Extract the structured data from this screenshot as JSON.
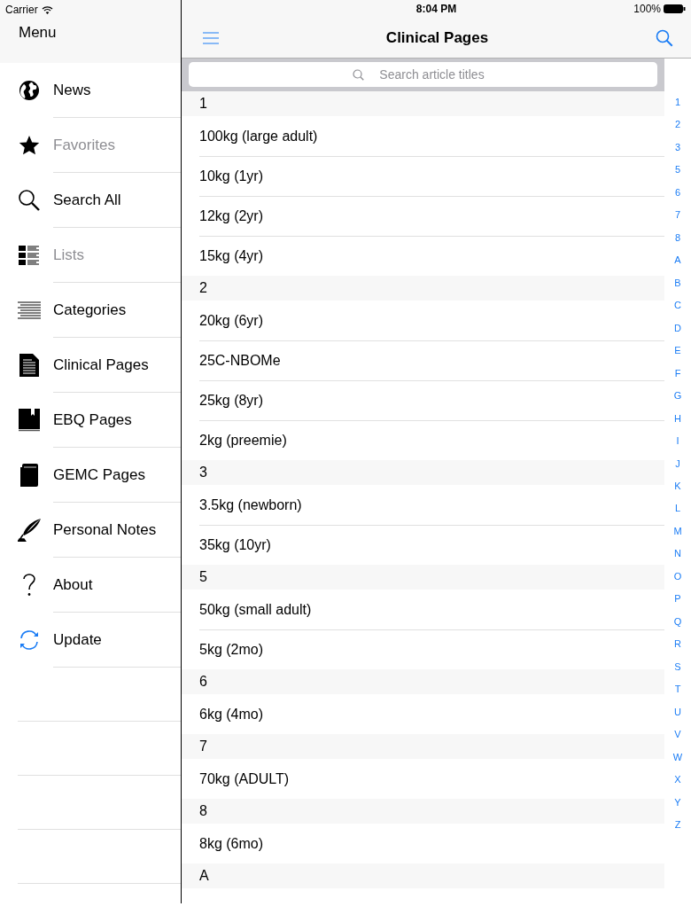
{
  "status_bar": {
    "carrier": "Carrier",
    "time": "8:04 PM",
    "battery": "100%"
  },
  "sidebar": {
    "title": "Menu",
    "items": [
      {
        "label": "News",
        "disabled": false
      },
      {
        "label": "Favorites",
        "disabled": true
      },
      {
        "label": "Search All",
        "disabled": false
      },
      {
        "label": "Lists",
        "disabled": true
      },
      {
        "label": "Categories",
        "disabled": false
      },
      {
        "label": "Clinical Pages",
        "disabled": false
      },
      {
        "label": "EBQ Pages",
        "disabled": false
      },
      {
        "label": "GEMC Pages",
        "disabled": false
      },
      {
        "label": "Personal Notes",
        "disabled": false
      },
      {
        "label": "About",
        "disabled": false
      },
      {
        "label": "Update",
        "disabled": false
      }
    ]
  },
  "nav_bar": {
    "title": "Clinical Pages"
  },
  "search": {
    "placeholder": "Search article titles"
  },
  "sections": [
    {
      "header": "1",
      "rows": [
        "100kg (large adult)",
        "10kg (1yr)",
        "12kg (2yr)",
        "15kg (4yr)"
      ]
    },
    {
      "header": "2",
      "rows": [
        "20kg (6yr)",
        "25C-NBOMe",
        "25kg (8yr)",
        "2kg (preemie)"
      ]
    },
    {
      "header": "3",
      "rows": [
        "3.5kg (newborn)",
        "35kg (10yr)"
      ]
    },
    {
      "header": "5",
      "rows": [
        "50kg (small adult)",
        "5kg (2mo)"
      ]
    },
    {
      "header": "6",
      "rows": [
        "6kg (4mo)"
      ]
    },
    {
      "header": "7",
      "rows": [
        "70kg (ADULT)"
      ]
    },
    {
      "header": "8",
      "rows": [
        "8kg (6mo)"
      ]
    },
    {
      "header": "A"
    }
  ],
  "index": [
    "1",
    "2",
    "3",
    "5",
    "6",
    "7",
    "8",
    "A",
    "B",
    "C",
    "D",
    "E",
    "F",
    "G",
    "H",
    "I",
    "J",
    "K",
    "L",
    "M",
    "N",
    "O",
    "P",
    "Q",
    "R",
    "S",
    "T",
    "U",
    "V",
    "W",
    "X",
    "Y",
    "Z"
  ]
}
